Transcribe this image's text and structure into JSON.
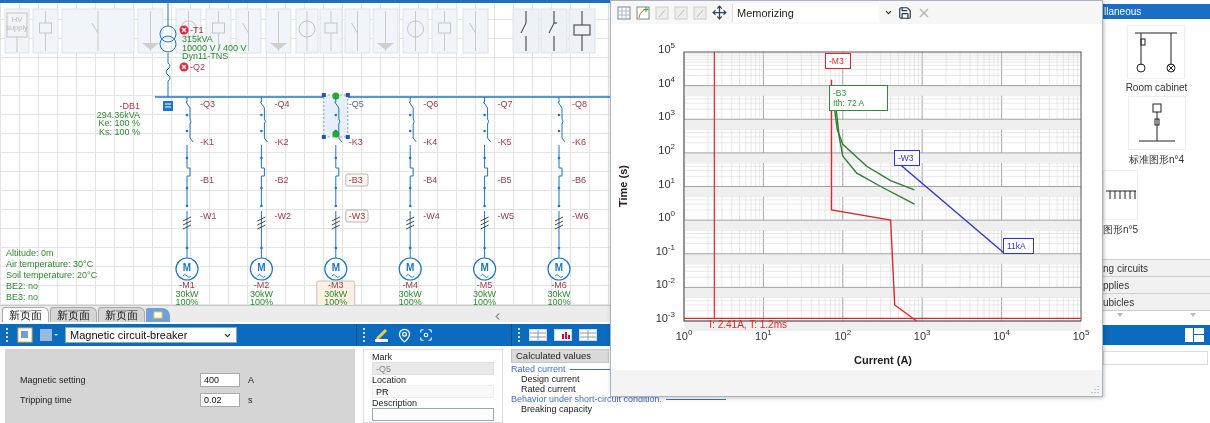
{
  "palette": {
    "hv_supply": [
      "HV",
      "supply"
    ]
  },
  "diagram": {
    "transformer": {
      "mark": "-T1",
      "lines": [
        "315kVA",
        "10000 V / 400 V",
        "Dyn11-TNS"
      ],
      "error": true
    },
    "incomer_breaker": {
      "mark": "-Q2",
      "error": true
    },
    "distribution_board": {
      "mark": "-DB1",
      "lines": [
        "294.36kVA",
        "Ke: 100 %",
        "Ks: 100 %"
      ]
    },
    "environment": [
      "Altitude: 0m",
      "Air temperature: 30°C",
      "Soil temperature: 20°C",
      "BE2: no",
      "BE3: no"
    ],
    "feeders": [
      {
        "breaker": "-Q3",
        "contactor": "-K1",
        "relay": "-B1",
        "cable": "-W1",
        "motor_letter": "M",
        "load": "-M1",
        "power": "30kW",
        "ratio": "100%",
        "selected": false
      },
      {
        "breaker": "-Q4",
        "contactor": "-K2",
        "relay": "-B2",
        "cable": "-W2",
        "motor_letter": "M",
        "load": "-M2",
        "power": "30kW",
        "ratio": "100%",
        "selected": false
      },
      {
        "breaker": "-Q5",
        "contactor": "-K3",
        "relay": "-B3",
        "cable": "-W3",
        "motor_letter": "M",
        "load": "-M3",
        "power": "30kW",
        "ratio": "100%",
        "selected": true
      },
      {
        "breaker": "-Q6",
        "contactor": "-K4",
        "relay": "-B4",
        "cable": "-W4",
        "motor_letter": "M",
        "load": "-M4",
        "power": "30kW",
        "ratio": "100%",
        "selected": false
      },
      {
        "breaker": "-Q7",
        "contactor": "-K5",
        "relay": "-B5",
        "cable": "-W5",
        "motor_letter": "M",
        "load": "-M5",
        "power": "30kW",
        "ratio": "100%",
        "selected": false
      },
      {
        "breaker": "-Q8",
        "contactor": "-K6",
        "relay": "-B6",
        "cable": "-W6",
        "motor_letter": "M",
        "load": "-M6",
        "power": "30kW",
        "ratio": "100%",
        "selected": false
      }
    ]
  },
  "page_tabs": [
    {
      "label": "新页面",
      "selected": true
    },
    {
      "label": "新页面",
      "selected": false
    },
    {
      "label": "新页面",
      "selected": false
    }
  ],
  "properties_toolbar": {
    "component_type": "Magnetic circuit-breaker"
  },
  "settings": [
    {
      "label": "Magnetic setting",
      "value": "400",
      "unit": "A"
    },
    {
      "label": "Tripping time",
      "value": "0.02",
      "unit": "s"
    }
  ],
  "identification": [
    {
      "label": "Mark",
      "value": "-Q5",
      "disabled": true
    },
    {
      "label": "Location",
      "value": "PR",
      "disabled": false
    },
    {
      "label": "Description",
      "disabled": false
    }
  ],
  "calculated": {
    "tab": "Calculated values",
    "groups": [
      {
        "title": "Rated current",
        "items": [
          "Design current",
          "Rated current"
        ]
      },
      {
        "title": "Behavior under short-circuit condition.",
        "items": [
          "Breaking capacity"
        ]
      }
    ]
  },
  "curve_window": {
    "mode": "Memorizing",
    "axes": {
      "xlabel": "Current (A)",
      "ylabel": "Time (s)",
      "x_tick_labels": [
        "10$^{0}$",
        "10$^{1}$",
        "10$^{2}$",
        "10$^{3}$",
        "10$^{4}$",
        "10$^{5}$"
      ],
      "y_tick_labels": [
        "10$^{5}$",
        "10$^{4}$",
        "10$^{3}$",
        "10$^{2}$",
        "10$^{1}$",
        "10$^{0}$",
        "10$^{-1}$",
        "10$^{-2}$",
        "10$^{-3}$"
      ]
    },
    "curve_tags": [
      {
        "lines": [
          "-M3"
        ],
        "color": "#e02828"
      },
      {
        "lines": [
          "-B3",
          "Ith: 72 A"
        ],
        "color": "#2e8b3e"
      },
      {
        "lines": [
          "-W3"
        ],
        "color": "#3434d0"
      },
      {
        "lines": [
          "11kA"
        ],
        "color": "#3434d0"
      }
    ],
    "cursor_readout": "I: 2.41A, T: 1.2ms"
  },
  "library": {
    "header": "llaneous",
    "items": [
      {
        "label": "Room cabinet",
        "kind": "cabinet"
      },
      {
        "label": "标准图形n°4",
        "kind": "standard"
      },
      {
        "label": "图形n°5",
        "kind": "strip"
      }
    ],
    "sections": [
      "ng circuits",
      "pplies",
      "ubicles"
    ]
  }
}
